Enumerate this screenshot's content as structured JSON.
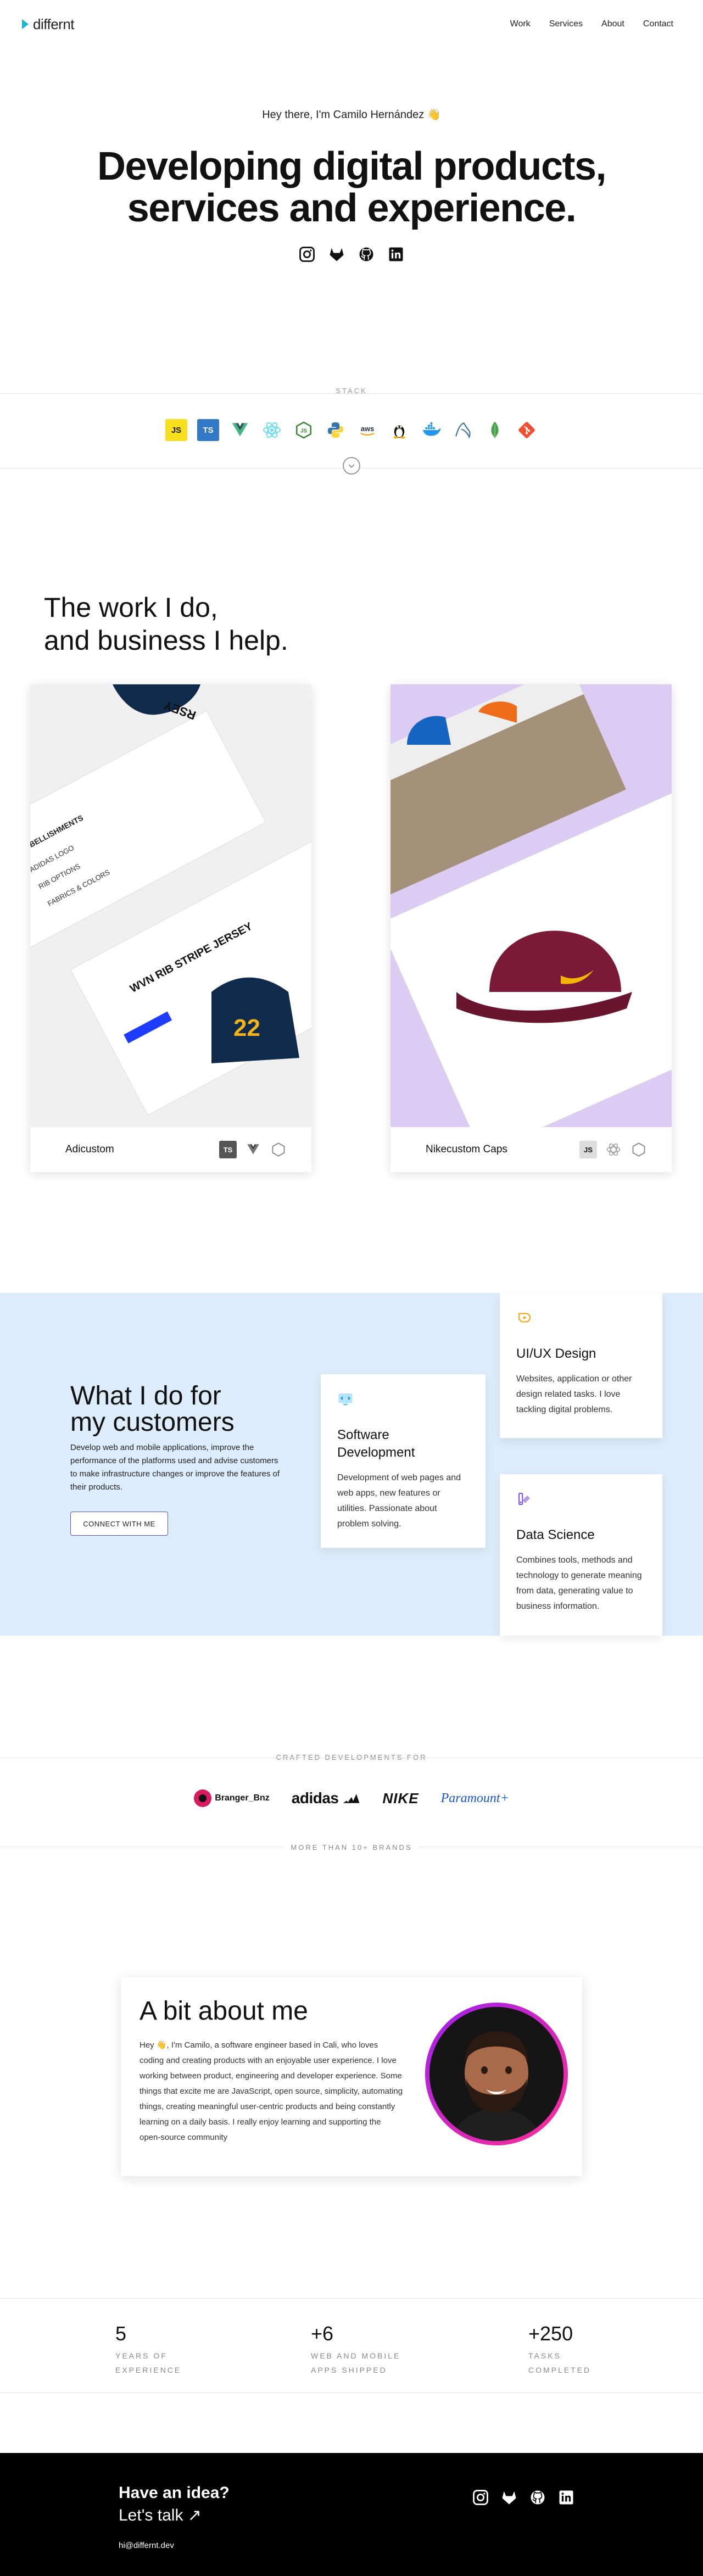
{
  "nav": {
    "logo_text": "differnt",
    "links": [
      "Work",
      "Services",
      "About",
      "Contact"
    ]
  },
  "hero": {
    "greeting": "Hey there, I'm Camilo Hernández 👋",
    "title_line1": "Developing digital products,",
    "title_line2": "services and experience."
  },
  "socials": [
    "instagram-icon",
    "gitlab-icon",
    "github-icon",
    "linkedin-icon"
  ],
  "stack": {
    "label": "STACK",
    "items": [
      {
        "icon": "javascript-icon",
        "label": "JS",
        "bg": "#f7df1e",
        "fg": "#111"
      },
      {
        "icon": "typescript-icon",
        "label": "TS",
        "bg": "#3178c6",
        "fg": "#fff"
      },
      {
        "icon": "vue-icon",
        "label": "V",
        "bg": "#ffffff",
        "fg": "#41b883"
      },
      {
        "icon": "react-icon",
        "label": "⚛",
        "bg": "#ffffff",
        "fg": "#61dafb"
      },
      {
        "icon": "nodejs-icon",
        "label": "⬡",
        "bg": "#ffffff",
        "fg": "#3c873a"
      },
      {
        "icon": "python-icon",
        "label": "Py",
        "bg": "#ffffff",
        "fg": "#3776ab"
      },
      {
        "icon": "aws-icon",
        "label": "aws",
        "bg": "#ffffff",
        "fg": "#232f3e"
      },
      {
        "icon": "linux-icon",
        "label": "🐧",
        "bg": "#ffffff",
        "fg": "#111"
      },
      {
        "icon": "docker-icon",
        "label": "🐳",
        "bg": "#ffffff",
        "fg": "#2496ed"
      },
      {
        "icon": "mysql-icon",
        "label": "⟋",
        "bg": "#ffffff",
        "fg": "#4479a1"
      },
      {
        "icon": "mongodb-icon",
        "label": "🍃",
        "bg": "#ffffff",
        "fg": "#47a248"
      },
      {
        "icon": "git-icon",
        "label": "◆",
        "bg": "#ffffff",
        "fg": "#f05032"
      }
    ]
  },
  "work": {
    "title_line1": "The work I do,",
    "title_line2": "and business I help.",
    "projects": [
      {
        "name": "Adicustom",
        "tags": [
          "typescript-icon",
          "vue-icon",
          "nodejs-icon"
        ],
        "image_text": "WVN RIB STRIPE JERSEY"
      },
      {
        "name": "Nikecustom Caps",
        "tags": [
          "javascript-icon",
          "react-icon",
          "nodejs-icon"
        ],
        "image_text": ""
      }
    ]
  },
  "services": {
    "title_line1": "What I do for",
    "title_line2": "my customers",
    "description": "Develop web and mobile applications, improve the performance of the platforms used and advise customers to make infrastructure changes or improve the features of their products.",
    "button": "CONNECT WITH ME",
    "cards": [
      {
        "title": "UI/UX Design",
        "text": "Websites, application or other design related tasks. I love tackling digital problems.",
        "icon": "palette-icon",
        "color": "#f5a623"
      },
      {
        "title": "Software Development",
        "text": "Development of web pages and web apps, new features or utilities. Passionate about problem solving.",
        "icon": "code-icon",
        "color": "#4fc3f7"
      },
      {
        "title": "Data Science",
        "text": "Combines tools, methods and technology to generate meaning from data, generating value to business information.",
        "icon": "chart-icon",
        "color": "#7c4dff"
      }
    ]
  },
  "brands": {
    "label_top": "CRAFTED DEVELOPMENTS FOR",
    "label_bottom": "MORE THAN 10+ BRANDS",
    "items": [
      "Branger_Bnz",
      "adidas",
      "NIKE",
      "Paramount+"
    ]
  },
  "about": {
    "title": "A bit about me",
    "text": "Hey 👋, I'm Camilo, a software engineer based in Cali, who loves coding and creating products with an enjoyable user experience. I love working between product, engineering and developer experience. Some things that excite me are JavaScript, open source, simplicity, automating things, creating meaningful user-centric products and being constantly learning on a daily basis. I really enjoy learning and supporting the open-source community"
  },
  "stats": [
    {
      "value": "5",
      "label_line1": "YEARS OF",
      "label_line2": "EXPERIENCE"
    },
    {
      "value": "+6",
      "label_line1": "WEB AND MOBILE",
      "label_line2": "APPS SHIPPED"
    },
    {
      "value": "+250",
      "label_line1": "TASKS",
      "label_line2": "COMPLETED"
    }
  ],
  "footer": {
    "line1": "Have an idea?",
    "line2": "Let's talk ↗",
    "email": "hi@differnt.dev"
  }
}
